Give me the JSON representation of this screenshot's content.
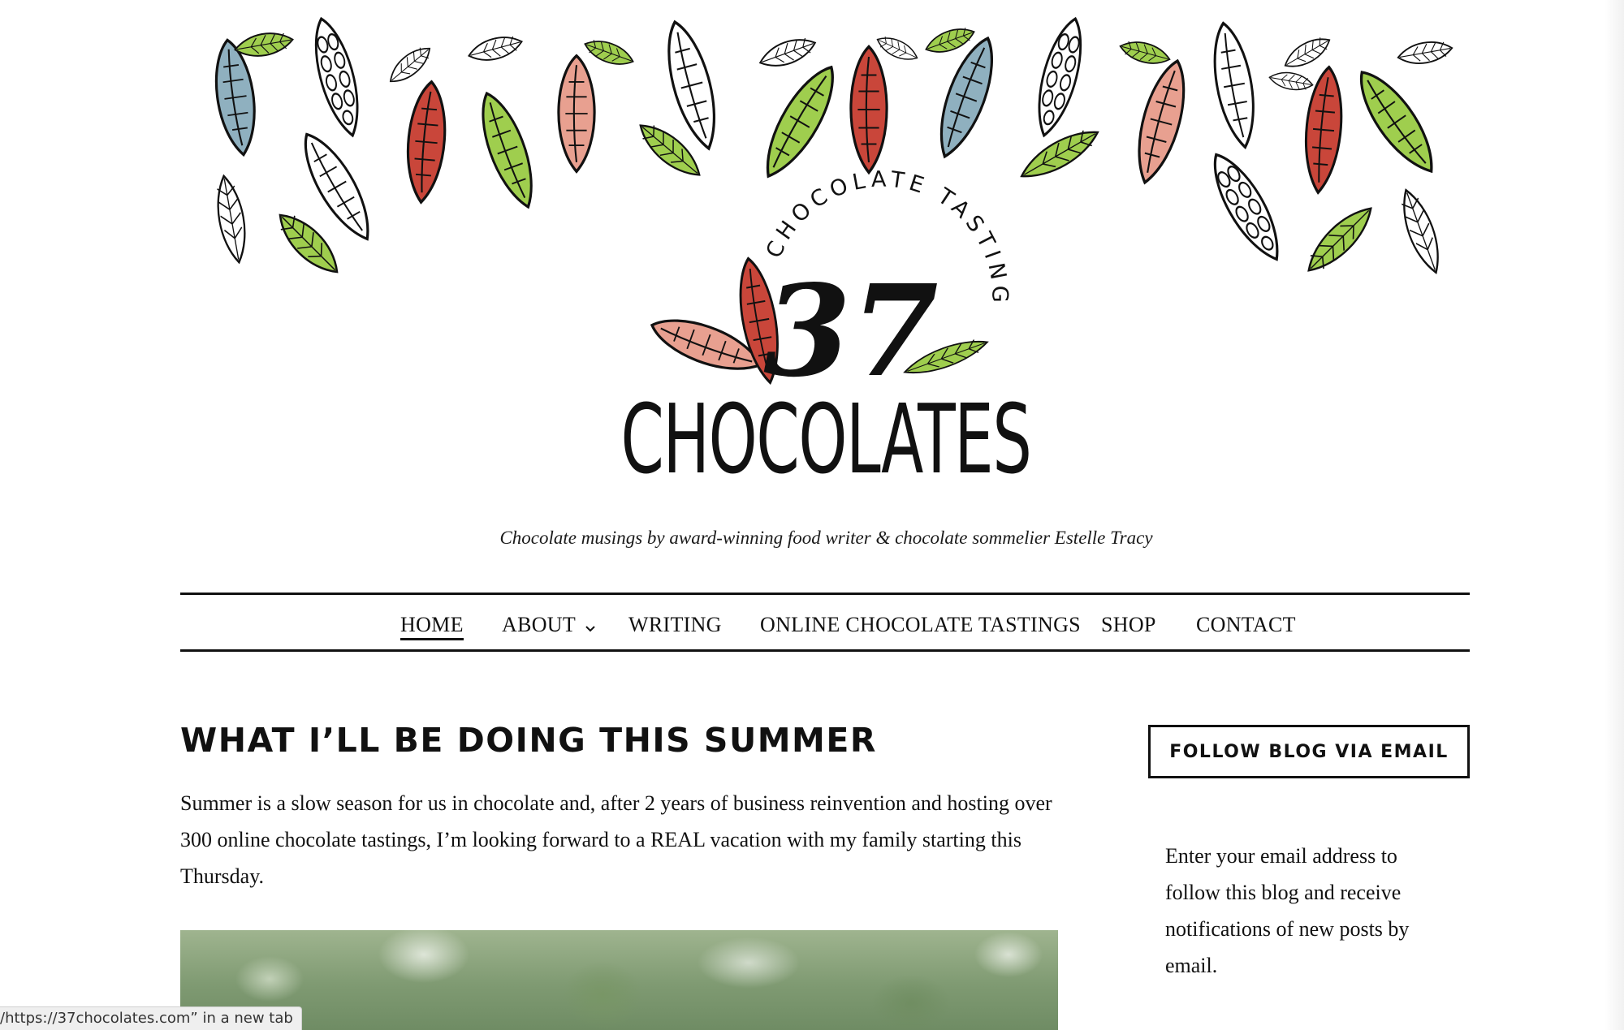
{
  "site": {
    "logo_number": "37",
    "logo_word": "CHOCOLATES",
    "logo_arc_text": "CHOCOLATE TASTINGS",
    "tagline": "Chocolate musings by award-winning food writer & chocolate sommelier Estelle Tracy"
  },
  "nav": {
    "items": [
      {
        "label": "HOME",
        "active": true
      },
      {
        "label": "ABOUT",
        "has_dropdown": true
      },
      {
        "label": "WRITING"
      },
      {
        "label": "ONLINE CHOCOLATE TASTINGS"
      },
      {
        "label": "SHOP"
      },
      {
        "label": "CONTACT"
      }
    ]
  },
  "post": {
    "title": "WHAT I’LL BE DOING THIS SUMMER",
    "excerpt": "Summer is a slow season for us in chocolate and, after 2 years of business reinvention and hosting over 300 online chocolate tastings, I’m looking forward to a REAL vacation with my family starting this Thursday."
  },
  "sidebar": {
    "follow_title": "FOLLOW BLOG VIA EMAIL",
    "follow_text": "Enter your email address to follow this blog and receive notifications of new posts by email."
  },
  "status_bar": {
    "text": "/https://37chocolates.com” in a new tab"
  },
  "colors": {
    "pod_red": "#c9463a",
    "pod_pink": "#e8a090",
    "pod_blue": "#8fb0bf",
    "leaf_green": "#9fce4e",
    "ink": "#111111"
  },
  "icons": [
    "cacao-pod-icon",
    "leaf-icon",
    "chevron-down-icon"
  ]
}
